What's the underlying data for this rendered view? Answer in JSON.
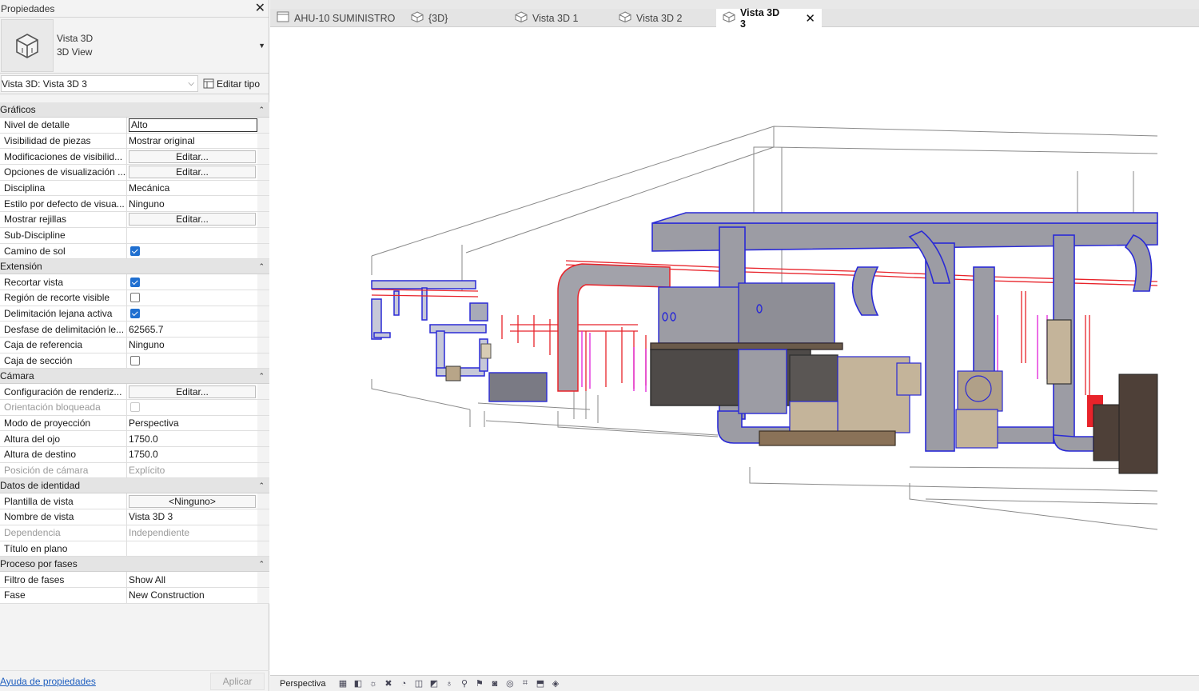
{
  "properties": {
    "title": "Propiedades",
    "type_name": "Vista 3D",
    "type_subname": "3D View",
    "instance": "Vista 3D: Vista 3D 3",
    "edit_type": "Editar tipo",
    "help_link": "Ayuda de propiedades",
    "apply": "Aplicar",
    "categories": [
      {
        "label": "Gráficos",
        "rows": [
          {
            "name": "Nivel de detalle",
            "value": "Alto",
            "kind": "input"
          },
          {
            "name": "Visibilidad de piezas",
            "value": "Mostrar original",
            "kind": "text"
          },
          {
            "name": "Modificaciones de visibilid...",
            "value": "Editar...",
            "kind": "button"
          },
          {
            "name": "Opciones de visualización ...",
            "value": "Editar...",
            "kind": "button"
          },
          {
            "name": "Disciplina",
            "value": "Mecánica",
            "kind": "text"
          },
          {
            "name": "Estilo por defecto de visua...",
            "value": "Ninguno",
            "kind": "text"
          },
          {
            "name": "Mostrar rejillas",
            "value": "Editar...",
            "kind": "button"
          },
          {
            "name": "Sub-Discipline",
            "value": "",
            "kind": "text"
          },
          {
            "name": "Camino de sol",
            "value": "",
            "kind": "checkbox",
            "checked": true
          }
        ]
      },
      {
        "label": "Extensión",
        "rows": [
          {
            "name": "Recortar vista",
            "value": "",
            "kind": "checkbox",
            "checked": true
          },
          {
            "name": "Región de recorte visible",
            "value": "",
            "kind": "checkbox",
            "checked": false
          },
          {
            "name": "Delimitación lejana activa",
            "value": "",
            "kind": "checkbox",
            "checked": true
          },
          {
            "name": "Desfase de delimitación le...",
            "value": "62565.7",
            "kind": "text"
          },
          {
            "name": "Caja de referencia",
            "value": "Ninguno",
            "kind": "text"
          },
          {
            "name": "Caja de sección",
            "value": "",
            "kind": "checkbox",
            "checked": false
          }
        ]
      },
      {
        "label": "Cámara",
        "rows": [
          {
            "name": "Configuración de renderiz...",
            "value": "Editar...",
            "kind": "button"
          },
          {
            "name": "Orientación bloqueada",
            "value": "",
            "kind": "checkbox",
            "checked": false,
            "disabled": true
          },
          {
            "name": "Modo de proyección",
            "value": "Perspectiva",
            "kind": "text"
          },
          {
            "name": "Altura del ojo",
            "value": "1750.0",
            "kind": "text"
          },
          {
            "name": "Altura de destino",
            "value": "1750.0",
            "kind": "text"
          },
          {
            "name": "Posición de cámara",
            "value": "Explícito",
            "kind": "text",
            "disabled": true
          }
        ]
      },
      {
        "label": "Datos de identidad",
        "rows": [
          {
            "name": "Plantilla de vista",
            "value": "<Ninguno>",
            "kind": "button"
          },
          {
            "name": "Nombre de vista",
            "value": "Vista 3D 3",
            "kind": "text"
          },
          {
            "name": "Dependencia",
            "value": "Independiente",
            "kind": "text",
            "disabled": true
          },
          {
            "name": "Título en plano",
            "value": "",
            "kind": "text"
          }
        ]
      },
      {
        "label": "Proceso por fases",
        "rows": [
          {
            "name": "Filtro de fases",
            "value": "Show All",
            "kind": "text"
          },
          {
            "name": "Fase",
            "value": "New Construction",
            "kind": "text"
          }
        ]
      }
    ]
  },
  "tabs": [
    {
      "label": "AHU-10 SUMINISTRO",
      "icon": "floor-plan-icon",
      "active": false
    },
    {
      "label": "{3D}",
      "icon": "3d-view-icon",
      "active": false
    },
    {
      "label": "Vista 3D 1",
      "icon": "3d-view-icon",
      "active": false
    },
    {
      "label": "Vista 3D 2",
      "icon": "3d-view-icon",
      "active": false
    },
    {
      "label": "Vista 3D 3",
      "icon": "3d-view-icon",
      "active": true
    }
  ],
  "viewbar": {
    "projection": "Perspectiva",
    "icons": [
      "detail-level-icon",
      "visual-style-icon",
      "sun-path-icon",
      "shadows-icon",
      "rendering-icon",
      "crop-view-icon",
      "show-crop-icon",
      "unlock-view-icon",
      "temporary-hide-icon",
      "reveal-hidden-icon",
      "lock-3d-icon",
      "temporary-properties-icon",
      "worksharing-icon",
      "analytical-model-icon",
      "highlight-displacement-icon"
    ]
  },
  "colors": {
    "duct_supply": "#9c9ca4",
    "duct_edge": "#2a2ad6",
    "pipe_red": "#e8232a",
    "pipe_magenta": "#e020d8",
    "equipment_tan": "#c4b49a",
    "equipment_dark": "#4e4a48"
  }
}
